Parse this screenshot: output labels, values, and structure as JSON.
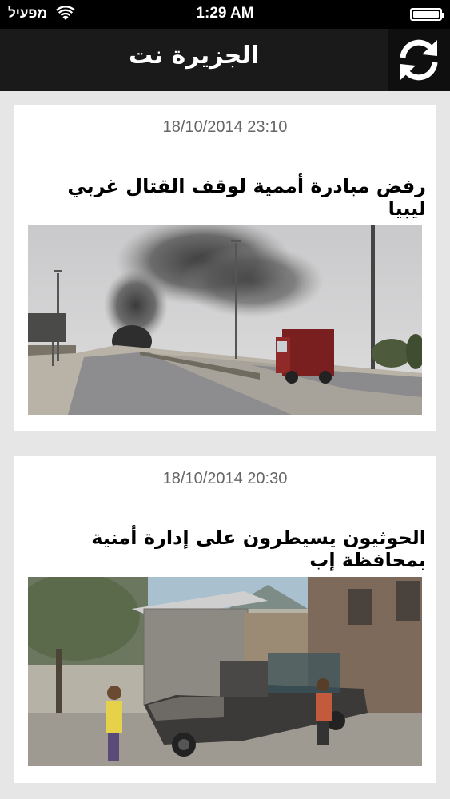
{
  "status_bar": {
    "carrier": "מפעיל",
    "time": "1:29 AM"
  },
  "nav": {
    "title": "الجزيرة نت",
    "refresh_icon": "refresh-icon"
  },
  "articles": [
    {
      "date": "18/10/2014 23:10",
      "headline": "رفض مبادرة أممية لوقف القتال غربي ليبيا"
    },
    {
      "date": "18/10/2014 20:30",
      "headline": "الحوثيون يسيطرون على إدارة أمنية بمحافظة إب"
    }
  ]
}
